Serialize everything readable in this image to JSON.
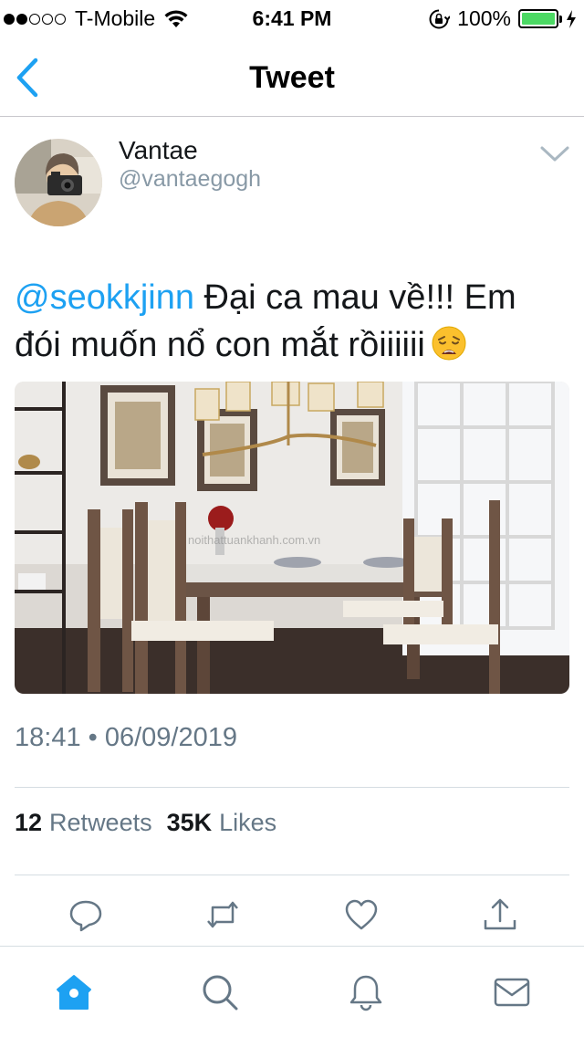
{
  "status_bar": {
    "signal_filled": 2,
    "signal_total": 5,
    "carrier": "T-Mobile",
    "time": "6:41 PM",
    "battery": "100%",
    "battery_level": 1.0
  },
  "nav": {
    "title": "Tweet",
    "back_icon": "chevron-left-icon"
  },
  "tweet": {
    "display_name": "Vantae",
    "handle": "@vantaegogh",
    "mention": "@seokkjinn",
    "text": " Đại ca mau về!!! Em đói muốn nổ con mắt rồiiiiii",
    "emoji": "weary-face-emoji",
    "media_watermark": "noithattuankhanh.com.vn",
    "timestamp": "18:41 • 06/09/2019",
    "retweet_count": "12",
    "retweet_label": "Retweets",
    "like_count": "35K",
    "like_label": "Likes"
  },
  "actions": [
    {
      "name": "reply",
      "icon": "reply-icon"
    },
    {
      "name": "retweet",
      "icon": "retweet-icon"
    },
    {
      "name": "like",
      "icon": "heart-icon"
    },
    {
      "name": "share",
      "icon": "share-icon"
    }
  ],
  "tabs": [
    {
      "name": "home",
      "icon": "home-icon",
      "active": true
    },
    {
      "name": "search",
      "icon": "search-icon",
      "active": false
    },
    {
      "name": "notifications",
      "icon": "bell-icon",
      "active": false
    },
    {
      "name": "messages",
      "icon": "mail-icon",
      "active": false
    }
  ],
  "colors": {
    "accent": "#1da1f2",
    "secondary_text": "#657786",
    "handle": "#8899a6",
    "battery_green": "#4cd964"
  }
}
